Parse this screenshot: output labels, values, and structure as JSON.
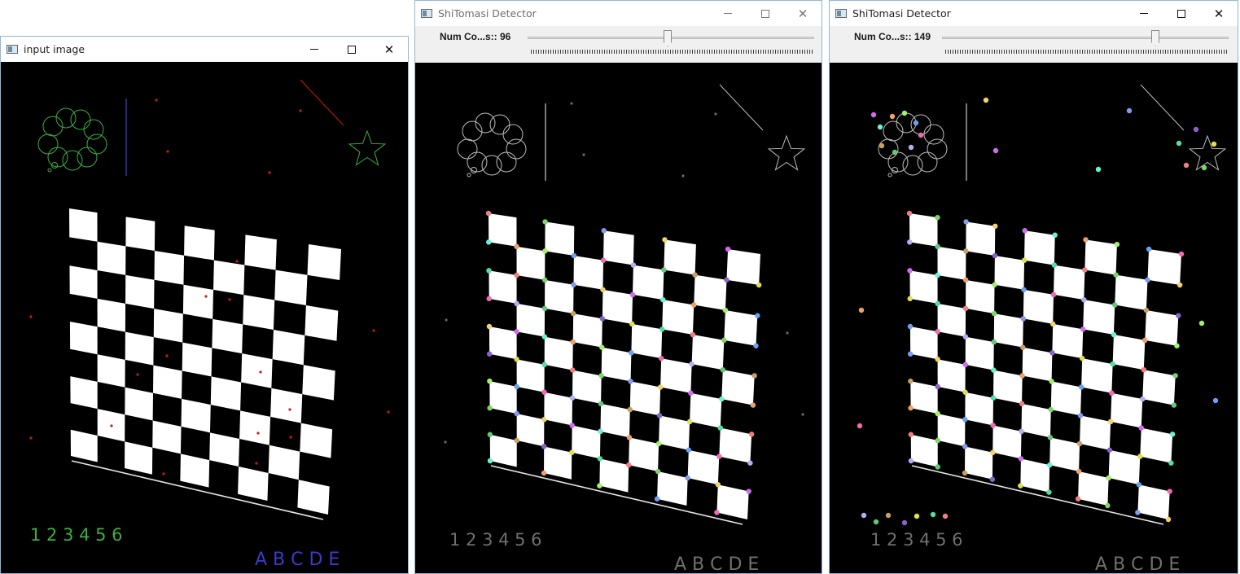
{
  "windows": [
    {
      "id": "input",
      "title": "input image",
      "has_trackbar": false
    },
    {
      "id": "det1",
      "title": "ShiTomasi Detector",
      "has_trackbar": true,
      "trackbar": {
        "label": "Num Co...s:: 96",
        "value": 96
      }
    },
    {
      "id": "det2",
      "title": "ShiTomasi Detector",
      "has_trackbar": true,
      "trackbar": {
        "label": "Num Co...s:: 149",
        "value": 149
      }
    }
  ],
  "controls": {
    "minimize": "minimize",
    "maximize": "maximize",
    "close": "✕"
  },
  "image_text": {
    "numbers": "1 2 3 4 5 6",
    "letters": "A B C D E"
  },
  "colors": {
    "input_numbers": "#3fae3f",
    "input_letters": "#3b3bc8",
    "input_shapes": "#3fae3f",
    "input_vline": "#3b3bc8",
    "input_diag": "#d01818",
    "gray_text": "#6f6f6f",
    "gray_lines": "#bdbdbd",
    "board_white": "#ffffff"
  },
  "icons": [
    "app-window-icon",
    "minimize-icon",
    "maximize-icon",
    "close-icon"
  ]
}
